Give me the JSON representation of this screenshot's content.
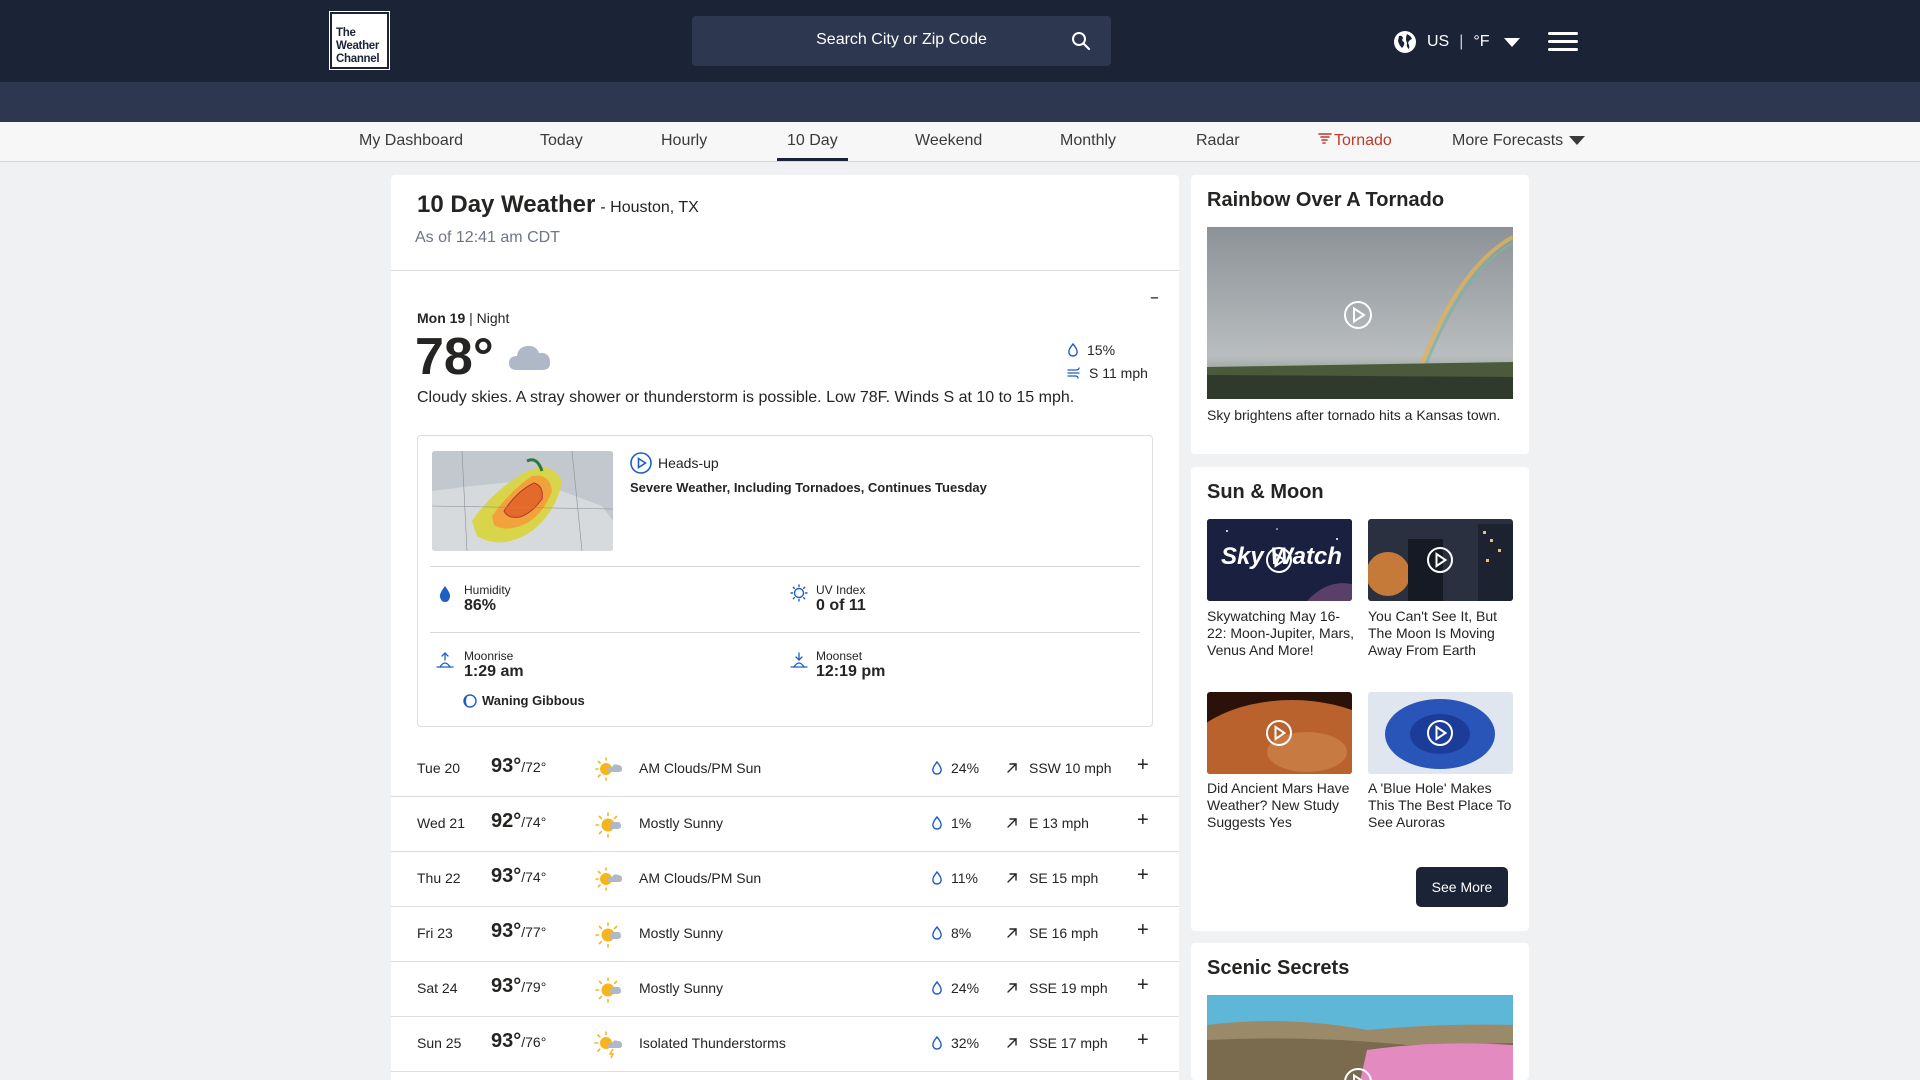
{
  "header": {
    "logo_lines": [
      "The",
      "Weather",
      "Channel"
    ],
    "search_placeholder": "Search City or Zip Code",
    "region": "US",
    "unit": "°F"
  },
  "nav": {
    "items": [
      "My Dashboard",
      "Today",
      "Hourly",
      "10 Day",
      "Weekend",
      "Monthly",
      "Radar",
      "Tornado",
      "More Forecasts"
    ],
    "active": "10 Day"
  },
  "main": {
    "title": "10 Day Weather",
    "location": "- Houston, TX",
    "as_of": "As of 12:41 am CDT",
    "collapse_symbol": "–",
    "current": {
      "day": "Mon 19",
      "period": " | Night",
      "temp": "78°",
      "condition_icon": "cloudy-icon",
      "rain": "15%",
      "wind": "S 11 mph",
      "description": "Cloudy skies. A stray shower or thunderstorm is possible. Low 78F. Winds S at 10 to 15 mph."
    },
    "video": {
      "tag": "Heads-up",
      "headline": "Severe Weather, Including Tornadoes, Continues Tuesday"
    },
    "details": {
      "humidity_label": "Humidity",
      "humidity": "86%",
      "uv_label": "UV Index",
      "uv": "0 of 11",
      "moonrise_label": "Moonrise",
      "moonrise": "1:29 am",
      "moonset_label": "Moonset",
      "moonset": "12:19 pm",
      "moon_phase": "Waning Gibbous"
    },
    "forecast": [
      {
        "day": "Tue 20",
        "hi": "93°",
        "lo": "/72°",
        "icon": "am-clouds-pm-sun-icon",
        "cond": "AM Clouds/PM Sun",
        "rain": "24%",
        "wind": "SSW 10 mph"
      },
      {
        "day": "Wed 21",
        "hi": "92°",
        "lo": "/74°",
        "icon": "mostly-sunny-icon",
        "cond": "Mostly Sunny",
        "rain": "1%",
        "wind": "E 13 mph"
      },
      {
        "day": "Thu 22",
        "hi": "93°",
        "lo": "/74°",
        "icon": "am-clouds-pm-sun-icon",
        "cond": "AM Clouds/PM Sun",
        "rain": "11%",
        "wind": "SE 15 mph"
      },
      {
        "day": "Fri 23",
        "hi": "93°",
        "lo": "/77°",
        "icon": "mostly-sunny-icon",
        "cond": "Mostly Sunny",
        "rain": "8%",
        "wind": "SE 16 mph"
      },
      {
        "day": "Sat 24",
        "hi": "93°",
        "lo": "/79°",
        "icon": "mostly-sunny-icon",
        "cond": "Mostly Sunny",
        "rain": "24%",
        "wind": "SSE 19 mph"
      },
      {
        "day": "Sun 25",
        "hi": "93°",
        "lo": "/76°",
        "icon": "isolated-thunderstorms-icon",
        "cond": "Isolated Thunderstorms",
        "rain": "32%",
        "wind": "SSE 17 mph"
      }
    ]
  },
  "sidebar": {
    "rainbow": {
      "title": "Rainbow Over A Tornado",
      "caption": "Sky brightens after tornado hits a Kansas town."
    },
    "sun_moon": {
      "title": "Sun & Moon",
      "thumb_text": "Sky Watch",
      "items": [
        "Skywatching May 16-22: Moon-Jupiter, Mars, Venus And More!",
        "You Can't See It, But The Moon Is Moving Away From Earth",
        "Did Ancient Mars Have Weather? New Study Suggests Yes",
        "A 'Blue Hole' Makes This The Best Place To See Auroras"
      ],
      "see_more": "See More"
    },
    "scenic": {
      "title": "Scenic Secrets"
    }
  },
  "colors": {
    "header_bg": "#1b2336",
    "subbar_bg": "#2d3750",
    "accent_blue": "#1f5fc4",
    "tornado_red": "#c0392b",
    "sun_yellow": "#f5b51f"
  }
}
